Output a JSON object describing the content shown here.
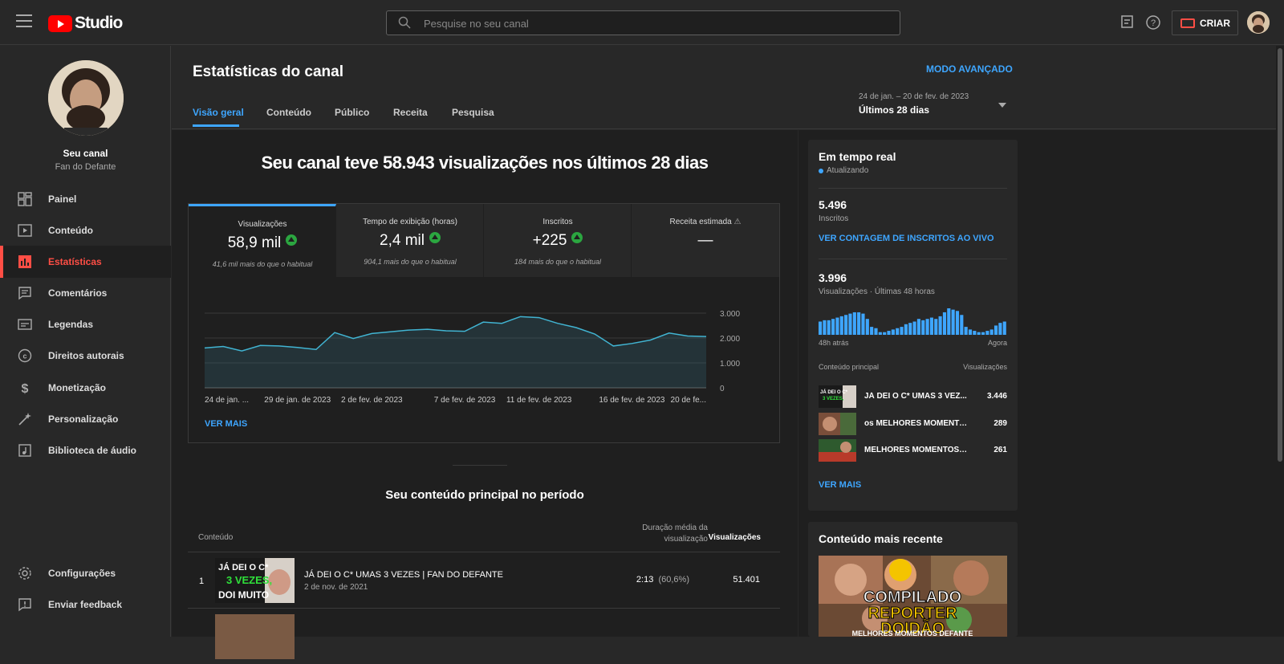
{
  "topbar": {
    "logo_text": "Studio",
    "search_placeholder": "Pesquise no seu canal",
    "create_label": "CRIAR"
  },
  "sidebar": {
    "channel_name": "Seu canal",
    "channel_sub": "Fan do Defante",
    "items": [
      {
        "label": "Painel",
        "icon": "dashboard-icon"
      },
      {
        "label": "Conteúdo",
        "icon": "content-icon"
      },
      {
        "label": "Estatísticas",
        "icon": "analytics-icon",
        "active": true
      },
      {
        "label": "Comentários",
        "icon": "comments-icon"
      },
      {
        "label": "Legendas",
        "icon": "subtitles-icon"
      },
      {
        "label": "Direitos autorais",
        "icon": "copyright-icon"
      },
      {
        "label": "Monetização",
        "icon": "monetization-icon"
      },
      {
        "label": "Personalização",
        "icon": "customization-icon"
      },
      {
        "label": "Biblioteca de áudio",
        "icon": "audio-library-icon"
      }
    ],
    "bottom_items": [
      {
        "label": "Configurações",
        "icon": "settings-icon"
      },
      {
        "label": "Enviar feedback",
        "icon": "feedback-icon"
      }
    ]
  },
  "header": {
    "title": "Estatísticas do canal",
    "advanced_mode": "MODO AVANÇADO",
    "tabs": [
      "Visão geral",
      "Conteúdo",
      "Público",
      "Receita",
      "Pesquisa"
    ],
    "range_dates": "24 de jan. – 20 de fev. de 2023",
    "range_label": "Últimos 28 dias"
  },
  "overview": {
    "headline": "Seu canal teve 58.943 visualizações nos últimos 28 dias",
    "metrics": [
      {
        "title": "Visualizações",
        "value": "58,9 mil",
        "hint": "41,6 mil mais do que o habitual",
        "trend": "up"
      },
      {
        "title": "Tempo de exibição (horas)",
        "value": "2,4 mil",
        "hint": "904,1 mais do que o habitual",
        "trend": "up"
      },
      {
        "title": "Inscritos",
        "value": "+225",
        "hint": "184 mais do que o habitual",
        "trend": "up"
      },
      {
        "title": "Receita estimada",
        "value": "—",
        "hint": "",
        "trend": "none"
      }
    ],
    "see_more": "VER MAIS"
  },
  "chart_data": {
    "type": "area",
    "title": "",
    "xlabel": "",
    "ylabel": "",
    "x_tick_labels": [
      "24 de jan. ...",
      "29 de jan. de 2023",
      "2 de fev. de 2023",
      "7 de fev. de 2023",
      "11 de fev. de 2023",
      "16 de fev. de 2023",
      "20 de fe..."
    ],
    "y_tick_labels": [
      "3.000",
      "2.000",
      "1.000",
      "0"
    ],
    "ylim": [
      0,
      3000
    ],
    "x": [
      "24 jan",
      "25 jan",
      "26 jan",
      "27 jan",
      "28 jan",
      "29 jan",
      "30 jan",
      "31 jan",
      "1 fev",
      "2 fev",
      "3 fev",
      "4 fev",
      "5 fev",
      "6 fev",
      "7 fev",
      "8 fev",
      "9 fev",
      "10 fev",
      "11 fev",
      "12 fev",
      "13 fev",
      "14 fev",
      "15 fev",
      "16 fev",
      "17 fev",
      "18 fev",
      "19 fev",
      "20 fev"
    ],
    "series": [
      {
        "values": [
          1600,
          1660,
          1480,
          1700,
          1680,
          1620,
          1540,
          2220,
          1980,
          2180,
          2250,
          2320,
          2350,
          2290,
          2270,
          2640,
          2590,
          2860,
          2820,
          2590,
          2420,
          2160,
          1680,
          1780,
          1920,
          2200,
          2080,
          2060
        ]
      }
    ],
    "grid": true
  },
  "top_content": {
    "title": "Seu conteúdo principal no período",
    "col_content": "Conteúdo",
    "col_duration": "Duração média da visualização",
    "col_views": "Visualizações",
    "rows": [
      {
        "rank": "1",
        "title": "JÁ DEI O C* UMAS 3 VEZES | FAN DO DEFANTE",
        "date": "2 de nov. de 2021",
        "duration": "2:13",
        "pct": "(60,6%)",
        "views": "51.401"
      }
    ]
  },
  "realtime": {
    "title": "Em tempo real",
    "updating": "Atualizando",
    "subs_value": "5.496",
    "subs_label": "Inscritos",
    "live_link": "VER CONTAGEM DE INSCRITOS AO VIVO",
    "views_value": "3.996",
    "views_label": "Visualizações · Últimas 48 horas",
    "ago_left": "48h atrás",
    "ago_right": "Agora",
    "bars": [
      0.5,
      0.55,
      0.55,
      0.6,
      0.65,
      0.7,
      0.75,
      0.8,
      0.85,
      0.85,
      0.8,
      0.6,
      0.3,
      0.25,
      0.1,
      0.1,
      0.15,
      0.2,
      0.25,
      0.3,
      0.4,
      0.45,
      0.5,
      0.6,
      0.55,
      0.6,
      0.65,
      0.6,
      0.7,
      0.85,
      1.0,
      0.95,
      0.9,
      0.75,
      0.3,
      0.2,
      0.15,
      0.1,
      0.1,
      0.15,
      0.2,
      0.35,
      0.45,
      0.5
    ],
    "col_content": "Conteúdo principal",
    "col_views": "Visualizações",
    "items": [
      {
        "title": "JÁ DEI O C* UMAS 3 VEZ...",
        "views": "3.446"
      },
      {
        "title": "os MELHORES MOMENTO...",
        "views": "289"
      },
      {
        "title": "MELHORES MOMENTOS D...",
        "views": "261"
      }
    ],
    "see_more": "VER MAIS"
  },
  "recent": {
    "title": "Conteúdo mais recente",
    "thumb_text_1": "COMPILADO",
    "thumb_text_2": "REPORTER",
    "thumb_text_3": "DOIDÃO",
    "thumb_text_4": "MELHORES MOMENTOS DEFANTE"
  },
  "thumb1": {
    "l1": "JÁ DEI O C*",
    "l2": "3 VEZES,",
    "l3": "DOI MUITO"
  }
}
